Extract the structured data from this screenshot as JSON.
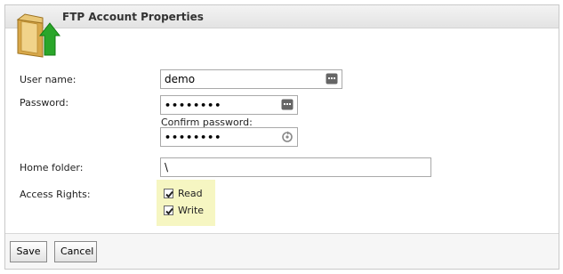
{
  "dialog": {
    "title": "FTP Account Properties"
  },
  "form": {
    "username_label": "User name:",
    "username_value": "demo",
    "password_label": "Password:",
    "password_value": "••••••••",
    "confirm_password_label": "Confirm password:",
    "confirm_password_value": "••••••••",
    "home_folder_label": "Home folder:",
    "home_folder_value": "\\",
    "access_rights_label": "Access Rights:",
    "access_rights": [
      {
        "label": "Read",
        "checked": true
      },
      {
        "label": "Write",
        "checked": true
      }
    ]
  },
  "footer": {
    "save_label": "Save",
    "cancel_label": "Cancel"
  },
  "icons": {
    "folder": "folder-upload-icon",
    "field_keyboard": "keyboard-icon",
    "password_generator": "refresh-icon"
  },
  "colors": {
    "access_highlight": "#f6f6c2",
    "header_bg": "#e8e8e8",
    "arrow_green": "#2aa62a"
  }
}
